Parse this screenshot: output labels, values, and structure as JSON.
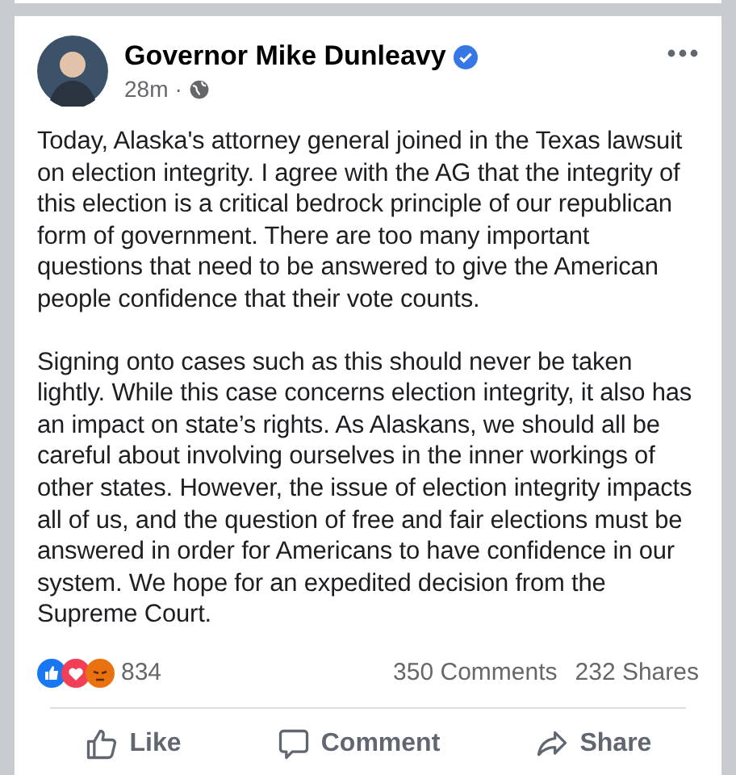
{
  "post": {
    "author": "Governor Mike Dunleavy",
    "verified": true,
    "time": "28m",
    "separator": "·",
    "paragraphs": [
      "Today, Alaska's attorney general joined in the Texas lawsuit on election integrity. I agree with the AG that the integrity of this election is a critical bedrock principle of our republican form of government. There are too many important questions that need to be answered to give the American people confidence that their vote counts.",
      "Signing onto cases such as this should never be taken lightly. While this case concerns election integrity, it also has an impact on state’s rights. As Alaskans, we should all be careful about involving ourselves in the inner workings of other states. However, the issue of election integrity impacts all of us, and the question of free and fair elections must be answered in order for Americans to have confidence in our system. We hope for an expedited decision from the Supreme Court."
    ],
    "reactions": {
      "count": "834",
      "comments": "350 Comments",
      "shares": "232 Shares"
    },
    "actions": [
      {
        "kind": "like",
        "label": "Like"
      },
      {
        "kind": "comment",
        "label": "Comment"
      },
      {
        "kind": "share",
        "label": "Share"
      }
    ]
  }
}
